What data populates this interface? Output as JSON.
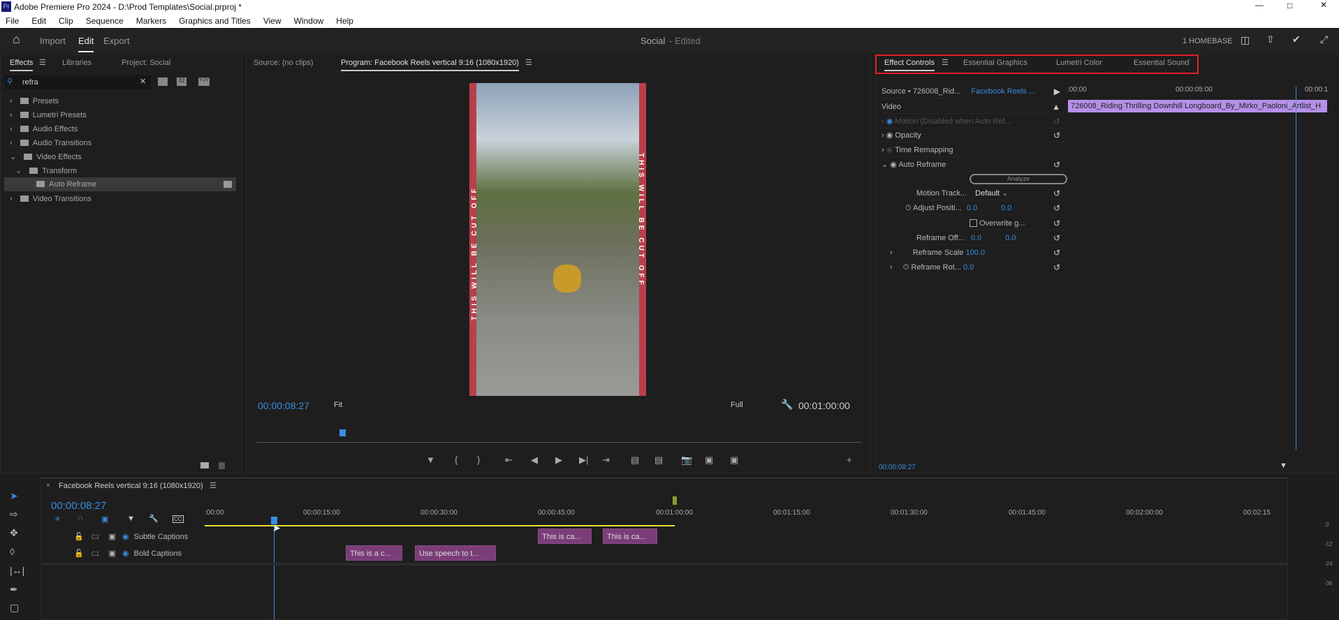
{
  "window": {
    "title": "Adobe Premiere Pro 2024 - D:\\Prod Templates\\Social.prproj *",
    "app_icon": "Pr"
  },
  "menu": [
    "File",
    "Edit",
    "Clip",
    "Sequence",
    "Markers",
    "Graphics and Titles",
    "View",
    "Window",
    "Help"
  ],
  "header": {
    "import": "Import",
    "edit": "Edit",
    "export": "Export",
    "project_title": "Social",
    "project_status": "- Edited",
    "workspace": "1 HOMEBASE"
  },
  "effects_panel": {
    "tabs": [
      "Effects",
      "Libraries",
      "Project: Social"
    ],
    "search_value": "refra",
    "filter_icons": [
      "accelerated-icon",
      "32",
      "YUV"
    ],
    "tree": [
      {
        "label": "Presets"
      },
      {
        "label": "Lumetri Presets"
      },
      {
        "label": "Audio Effects"
      },
      {
        "label": "Audio Transitions"
      },
      {
        "label": "Video Effects"
      },
      {
        "label": "Transform"
      },
      {
        "label": "Auto Reframe"
      },
      {
        "label": "Video Transitions"
      }
    ]
  },
  "monitor": {
    "source_tab": "Source: (no clips)",
    "program_tab": "Program: Facebook Reels vertical 9:16 (1080x1920)",
    "timecode": "00:00:08:27",
    "fit": "Fit",
    "quality": "Full",
    "duration": "00:01:00:00",
    "overlay_text": "THIS WILL BE CUT OFF"
  },
  "right_panel": {
    "tabs": [
      "Effect Controls",
      "Essential Graphics",
      "Lumetri Color",
      "Essential Sound"
    ],
    "source": "Source • 726008_Rid...",
    "sequence": "Facebook Reels ...",
    "section": "Video",
    "rows": {
      "motion": "Motion  (Disabled when Auto Ref...",
      "opacity": "Opacity",
      "time_remap": "Time Remapping",
      "auto_reframe": "Auto Reframe",
      "analyze": "Analyze",
      "motion_track_label": "Motion Track...",
      "motion_track_value": "Default",
      "adjust_pos_label": "Adjust Positi...",
      "adjust_x": "0.0",
      "adjust_y": "0.0",
      "overwrite": "Overwrite g...",
      "offset_label": "Reframe Off...",
      "offset_x": "0.0",
      "offset_y": "0.0",
      "scale_label": "Reframe Scale",
      "scale_value": "100.0",
      "rot_label": "Reframe Rot...",
      "rot_value": "0.0"
    },
    "ruler": [
      ":00:00",
      "00:00:05:00",
      "00:00:1"
    ],
    "clip_name": "726008_Riding Thrilling Downhill Longboard_By_Mirko_Paoloni_Artlist_H",
    "timecode": "00:00:08:27"
  },
  "timeline": {
    "title": "Facebook Reels vertical 9:16 (1080x1920)",
    "timecode": "00:00:08:27",
    "ruler": [
      ":00:00",
      "00:00:15:00",
      "00:00:30:00",
      "00:00:45:00",
      "00:01:00:00",
      "00:01:15:00",
      "00:01:30:00",
      "00:01:45:00",
      "00:02:00:00",
      "00:02:15"
    ],
    "tracks": [
      {
        "id": "C2",
        "name": "Subtle Captions",
        "clips": [
          "This is ca...",
          "This is ca..."
        ]
      },
      {
        "id": "C1",
        "name": "Bold Captions",
        "clips": [
          "This is a c...",
          "Use speech to t..."
        ]
      }
    ],
    "meter_labels": [
      "0",
      "-12",
      "-24",
      "-36"
    ]
  }
}
